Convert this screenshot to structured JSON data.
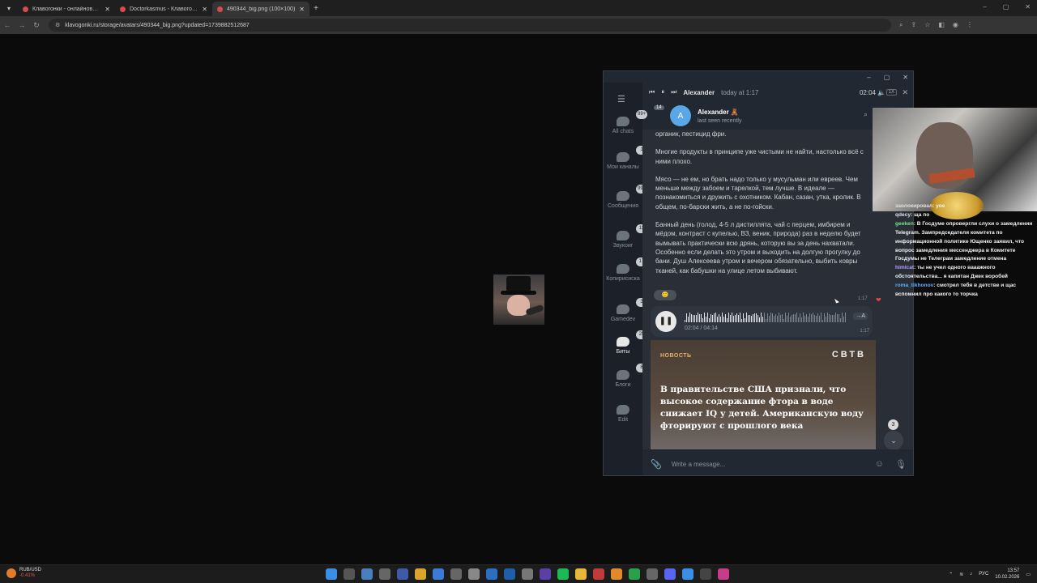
{
  "browser": {
    "tabs": [
      {
        "title": "Клавогонки - онлайновый кл...",
        "active": false
      },
      {
        "title": "Doctorkasmus - Клавогонки",
        "active": false
      },
      {
        "title": "490344_big.png (100×100)",
        "active": true
      }
    ],
    "url": "klavogonki.ru/storage/avatars/490344_big.png?updated=1739882512687"
  },
  "telegram": {
    "sidebar": [
      {
        "label": "All chats",
        "badge": "99+"
      },
      {
        "label": "Мои каналы",
        "badge": "1"
      },
      {
        "label": "Сообщения",
        "badge": "99+"
      },
      {
        "label": "Звукоиг",
        "badge": "13"
      },
      {
        "label": "Копирисиска",
        "badge": "17"
      },
      {
        "label": "Gamedev",
        "badge": "3"
      },
      {
        "label": "Биты",
        "badge": "25"
      },
      {
        "label": "Блоги",
        "badge": "8"
      },
      {
        "label": "Edit",
        "badge": ""
      }
    ],
    "player": {
      "author": "Alexander",
      "when": "today at 1:17",
      "time": "02:04",
      "speed": "1X"
    },
    "chat": {
      "back_badge": "14",
      "avatar_letter": "A",
      "name": "Alexander 🧸",
      "status": "last seen recently"
    },
    "message": {
      "paragraphs": [
        "органик, пестицид фри.",
        "Многие продукты в принципе уже чистыми не найти, настолько всё с ними плохо.",
        "Мясо — не ем, но брать надо только у мусульман или евреев. Чем меньше между забоем и тарелкой, тем лучше. В идеале — познакомиться и дружить с охотником. Кабан, сазан, утка, кролик. В общем, по-барски жить, а не по-гойски.",
        "Банный день (голод, 4-5 л дистиллята, чай с перцем, имбирем и мёдом, контраст с купелью, ВЗ, веник, природа) раз в неделю будет вымывать практически всю дрянь, которую вы за день нахватали. Особенно если делать это утром и выходить на долгую прогулку до бани. Душ Алексеева утром и вечером обязательно, выбить ковры тканей, как бабушки на улице летом выбивают."
      ],
      "reaction": "🙂",
      "time": "1:17"
    },
    "voice": {
      "progress": "02:04 / 04:14",
      "played_fraction": 0.49,
      "transcribe": "→A",
      "time": "1:17"
    },
    "news": {
      "tag": "НОВОСТЬ",
      "logo": "СВТВ",
      "headline": "В правительстве США признали, что высокое содержание фтора в воде снижает IQ у детей. Американскую воду фторируют с прошлого века"
    },
    "unread": "3",
    "composer_placeholder": "Write a message..."
  },
  "stream_chat": [
    {
      "user": "заолокировал",
      "text": "уое",
      "cls": "u1"
    },
    {
      "user": "qdecy",
      "text": "ща по",
      "cls": "u1"
    },
    {
      "user": "geeken",
      "text": "В Госдуме опровергли слухи о замедлении Telegram. Зампредседателя комитета по информационной политике Ющенко заявил, что вопрос замедления мессенджера в Комитете Госдумы не Телеграм замедление отмена",
      "cls": "u3"
    },
    {
      "user": "himicat",
      "text": "ты не учел одного вааажного обстоятельства... я капитан Джек воробей",
      "cls": "u4"
    },
    {
      "user": "roma_tikhonov",
      "text": "смотрел тебя в детстве и щас вспомнил про какого то торчка",
      "cls": "u5"
    }
  ],
  "taskbar": {
    "ticker_label": "RUB/USD",
    "ticker_change": "-0.41%",
    "lang": "РУС",
    "time": "13:57",
    "date": "10.02.2026"
  }
}
